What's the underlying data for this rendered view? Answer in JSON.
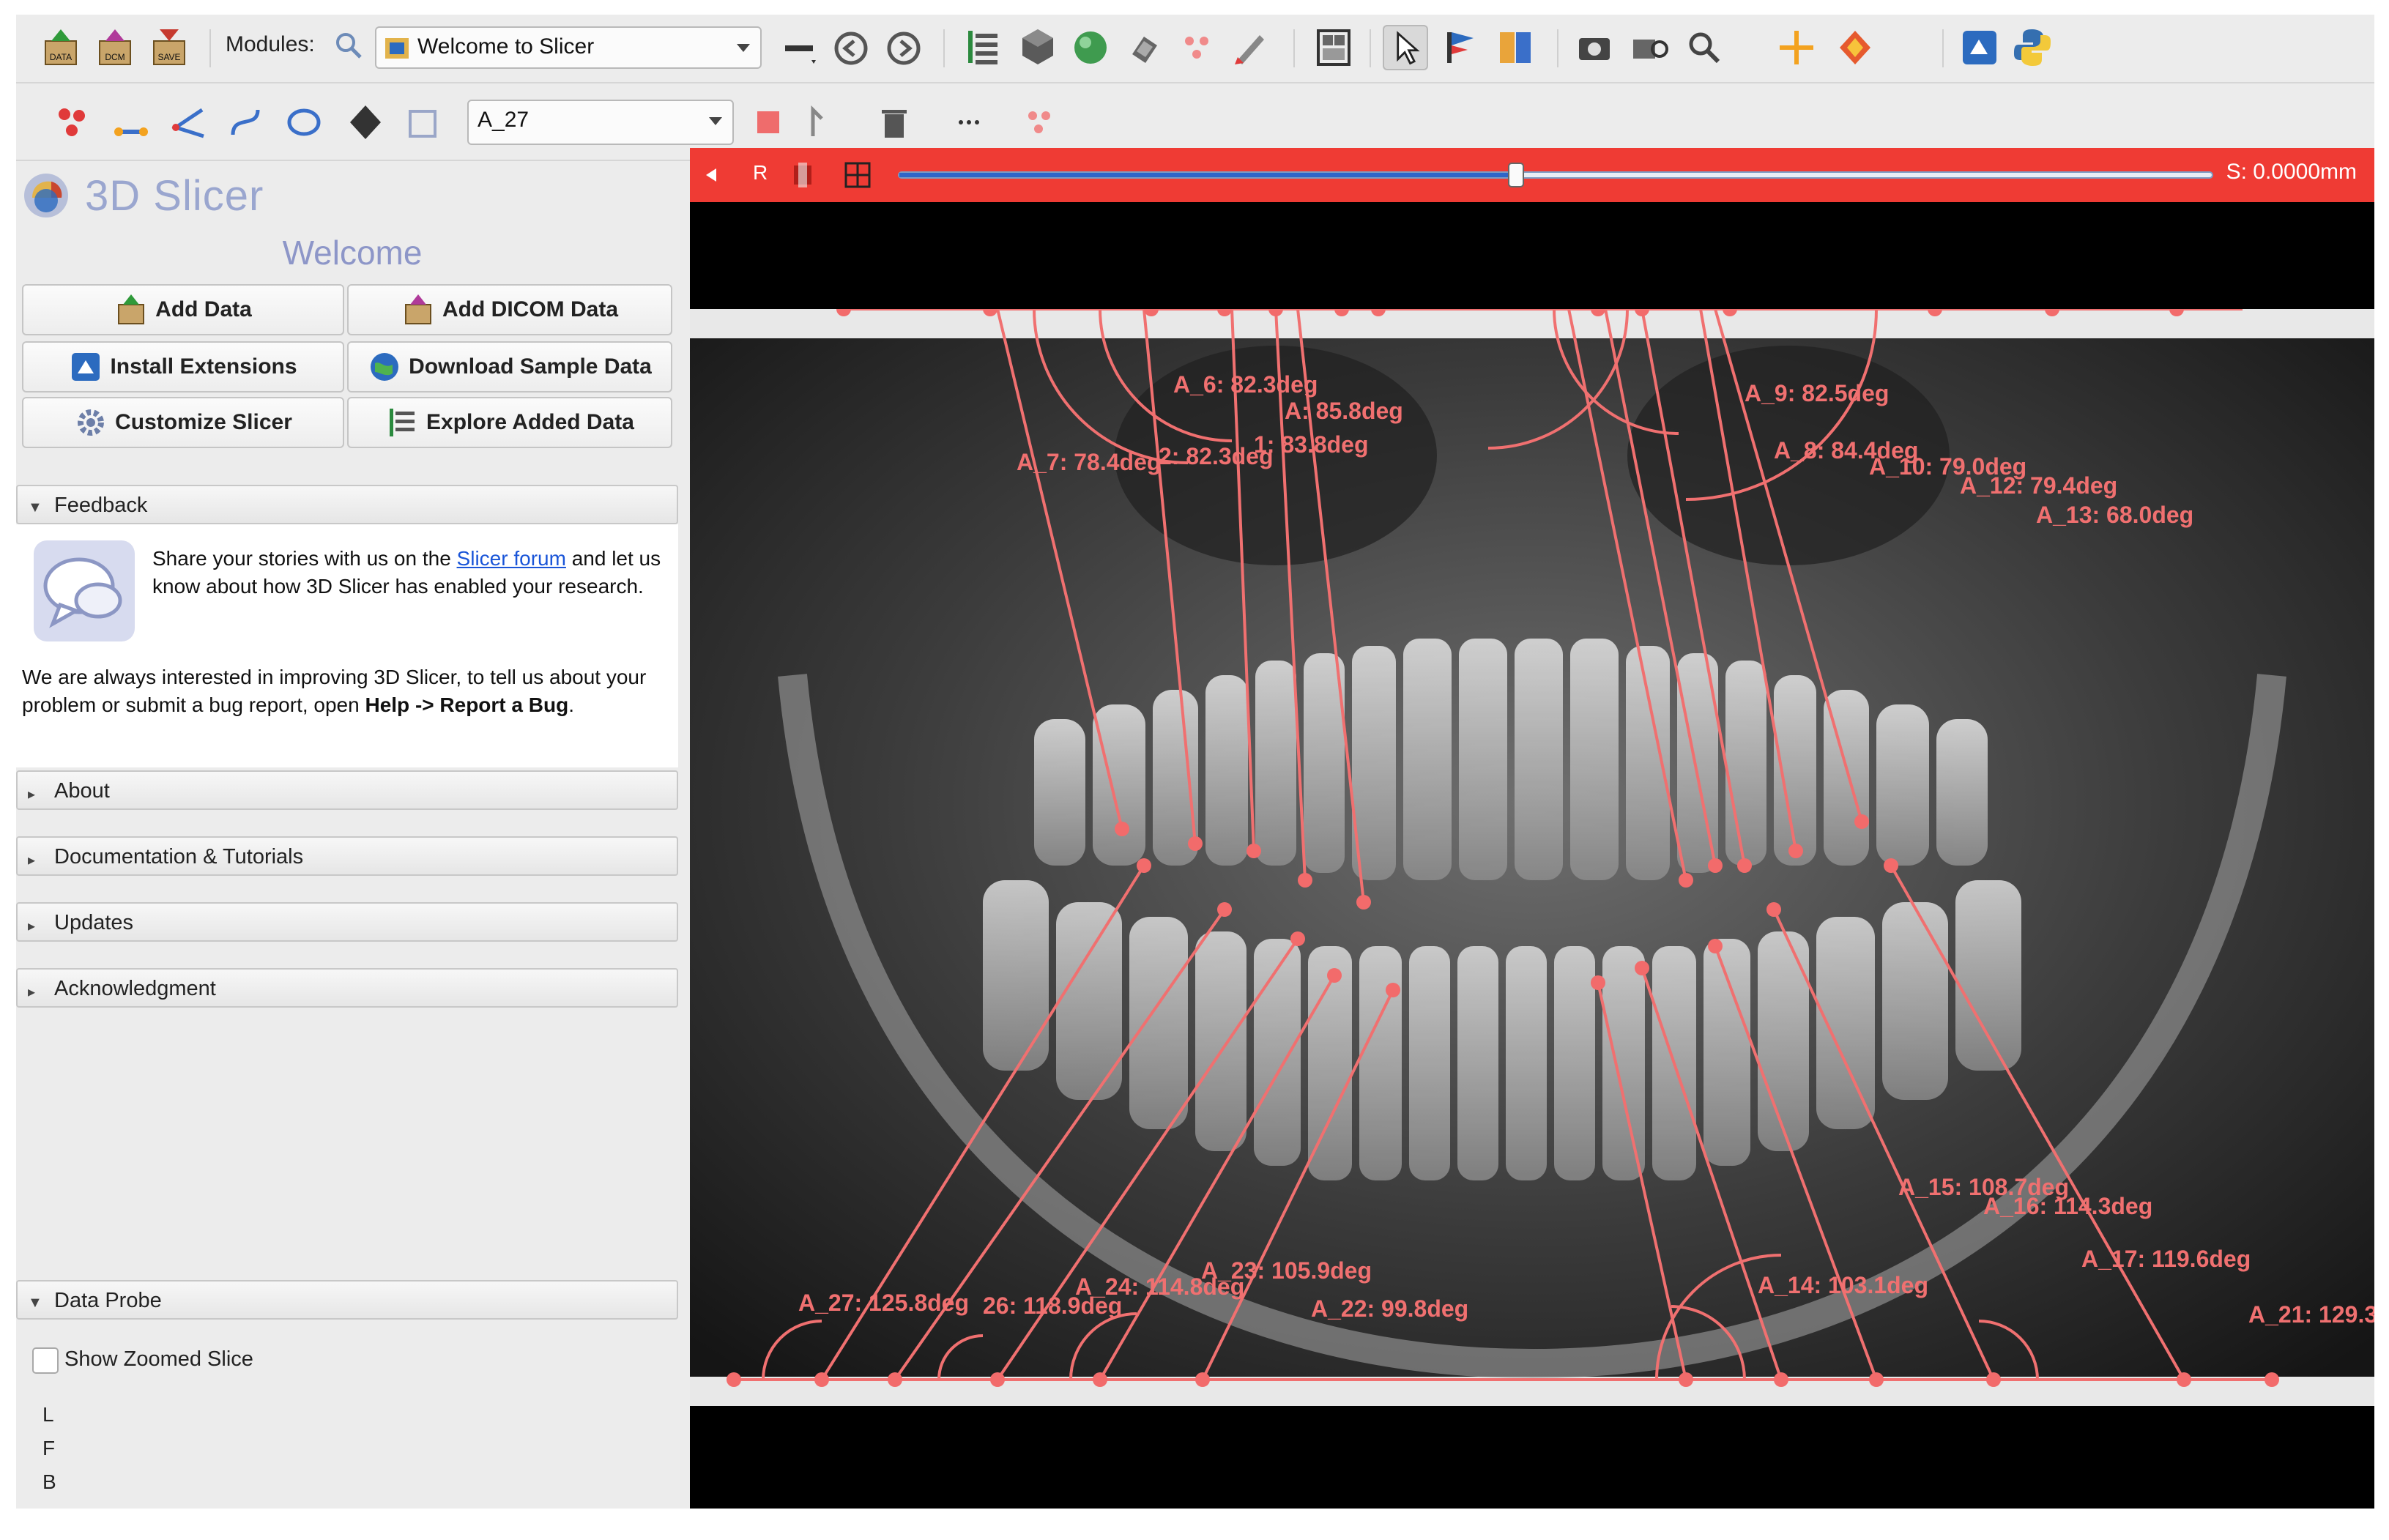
{
  "toolbar": {
    "modules_label": "Modules:",
    "module_selected": "Welcome to Slicer",
    "markup_selected": "A_27",
    "icons": [
      "data-icon",
      "dcm-icon",
      "save-icon",
      "search-icon",
      "layout-icon",
      "back-icon",
      "forward-icon",
      "data-tree-icon",
      "volumes-icon",
      "models-icon",
      "transforms-icon",
      "markups-icon",
      "editor-icon",
      "screen-layout-icon",
      "pointer-icon",
      "place-fiducial-icon",
      "crosshair-icon",
      "python-icon",
      "extension-manager-icon"
    ]
  },
  "welcome": {
    "brand": "3D Slicer",
    "title": "Welcome",
    "buttons": {
      "add_data": "Add Data",
      "add_dicom": "Add DICOM Data",
      "install_extensions": "Install Extensions",
      "download_sample": "Download Sample Data",
      "customize": "Customize Slicer",
      "explore_data": "Explore Added Data"
    }
  },
  "feedback": {
    "header": "Feedback",
    "p1_before": "Share your stories with us on the ",
    "p1_link": "Slicer forum",
    "p1_after": " and let us know about how 3D Slicer has enabled your research.",
    "p2_before": "We are always interested in improving 3D Slicer, to tell us about your problem or submit a bug report, open ",
    "p2_bold": "Help -> Report a Bug",
    "p2_after": "."
  },
  "sections": {
    "about": "About",
    "docs": "Documentation & Tutorials",
    "updates": "Updates",
    "acknowledgment": "Acknowledgment",
    "data_probe": "Data Probe"
  },
  "data_probe": {
    "show_zoomed": "Show Zoomed Slice",
    "rows": [
      "L",
      "F",
      "B"
    ]
  },
  "slice_view": {
    "orientation": "R",
    "offset": "S: 0.0000mm",
    "slider_fraction": 0.47,
    "color": "#ef3b34",
    "angles": [
      {
        "label": "A_6: 82.3deg"
      },
      {
        "label": "A: 85.8deg"
      },
      {
        "label": "1: 83.8deg"
      },
      {
        "label": "A_7: 78.4deg"
      },
      {
        "label": "2: 82.3deg"
      },
      {
        "label": "A_9: 82.5deg"
      },
      {
        "label": "A_8: 84.4deg"
      },
      {
        "label": "A_10: 79.0deg"
      },
      {
        "label": "A_12: 79.4deg"
      },
      {
        "label": "A_13: 68.0deg"
      },
      {
        "label": "A_15: 108.7deg"
      },
      {
        "label": "A_16: 114.3deg"
      },
      {
        "label": "A_17: 119.6deg"
      },
      {
        "label": "A_14: 103.1deg"
      },
      {
        "label": "A_21: 129.3"
      },
      {
        "label": "A_27: 125.8deg"
      },
      {
        "label": "26: 118.9deg"
      },
      {
        "label": "A_24: 114.8deg"
      },
      {
        "label": "A_23: 105.9deg"
      },
      {
        "label": "A_22: 99.8deg"
      }
    ]
  }
}
